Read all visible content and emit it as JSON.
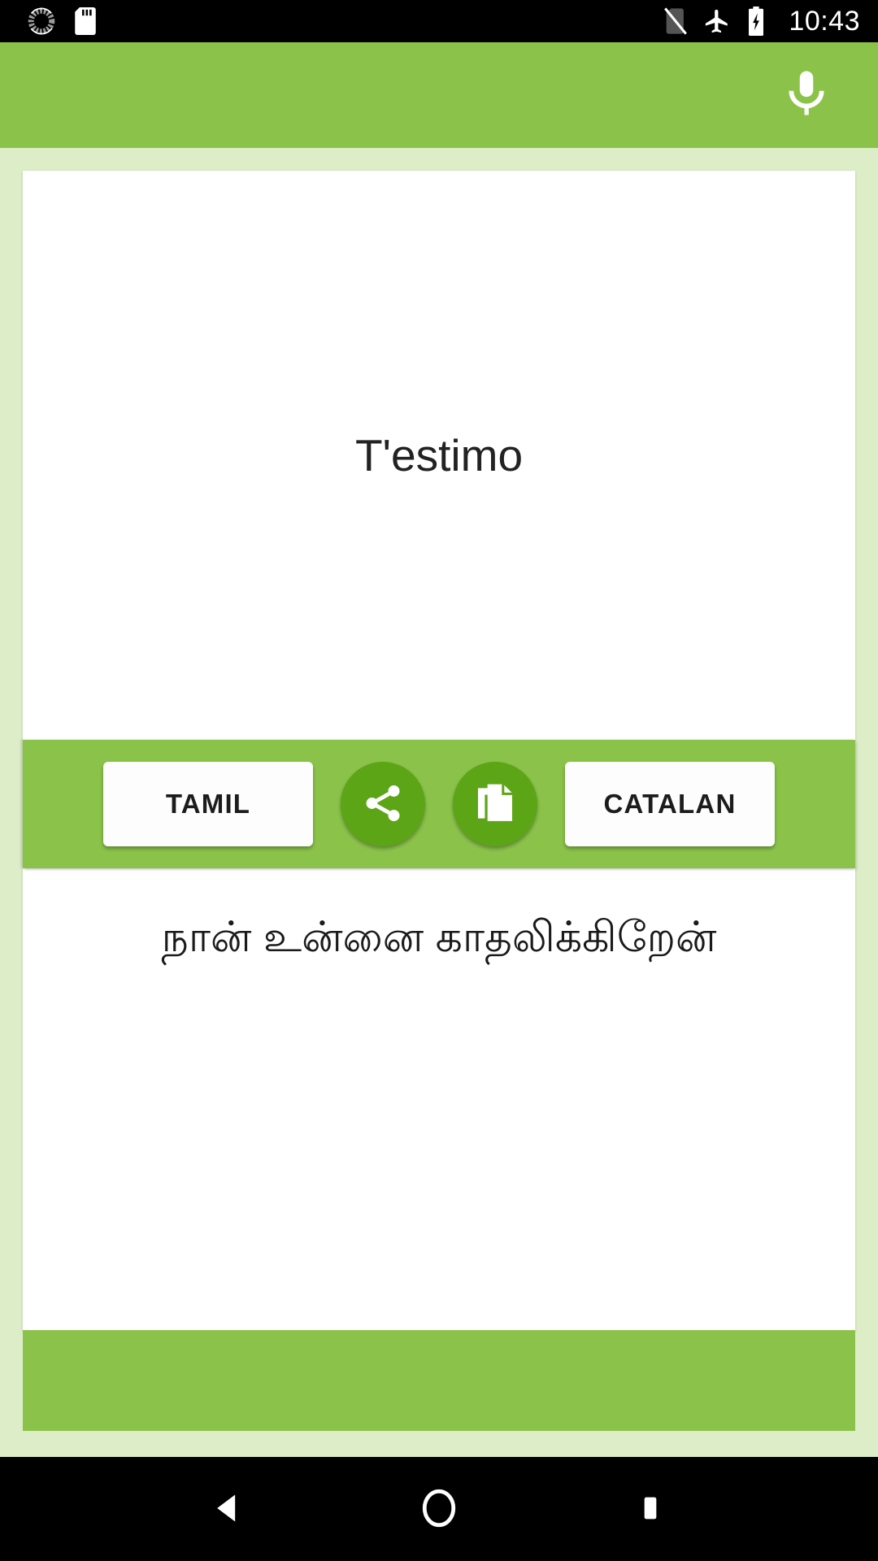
{
  "status_bar": {
    "time": "10:43",
    "icons_left": [
      "sync-spinner-icon",
      "sd-card-icon"
    ],
    "icons_right": [
      "no-sim-icon",
      "airplane-mode-icon",
      "battery-charging-icon"
    ]
  },
  "app_bar": {
    "mic_icon": "microphone-icon",
    "accent_color": "#8bc34a"
  },
  "translation": {
    "source_text": "T'estimo",
    "target_text": "நான் உன்னை காதலிக்கிறேன்"
  },
  "toolbar": {
    "source_language": "TAMIL",
    "target_language": "CATALAN",
    "share_icon": "share-icon",
    "copy_icon": "copy-icon",
    "button_color": "#5ca516"
  },
  "nav_bar": {
    "back": "back-icon",
    "home": "home-icon",
    "recents": "recents-icon"
  },
  "colors": {
    "accent": "#8bc34a",
    "background": "#dcedc8",
    "card": "#ffffff",
    "circle_button": "#5ca516"
  }
}
